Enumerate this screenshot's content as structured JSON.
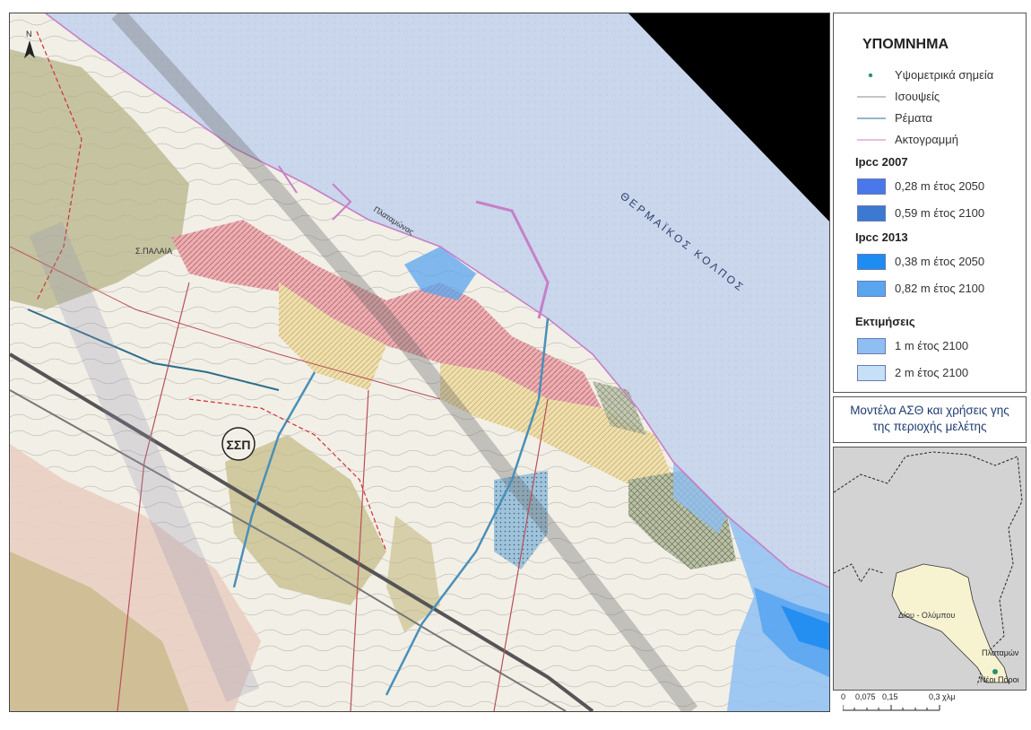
{
  "map": {
    "place_label": "Πλαταμώνας",
    "sea_label": "ΘΕΡΜΑΪΚΟΣ ΚΟΛΠΟΣ",
    "zone_label": "ΣΣΠ",
    "north_label": "N",
    "hill_label": "Σ.ΠΑΛΑΙΑ"
  },
  "legend": {
    "title": "ΥΠΟΜΝΗΜΑ",
    "items": [
      {
        "label": "Υψομετρικά σημεία",
        "symbol": "point",
        "color": "#2f8f6f"
      },
      {
        "label": "Ισουψείς",
        "symbol": "line",
        "color": "#8a8a8a"
      },
      {
        "label": "Ρέματα",
        "symbol": "line",
        "color": "#2c6e8c"
      },
      {
        "label": "Ακτογραμμή",
        "symbol": "line",
        "color": "#c77fc7"
      }
    ],
    "groups": [
      {
        "heading": "Ipcc 2007",
        "items": [
          {
            "label": "0,28 m έτος 2050",
            "color": "#4a78ea"
          },
          {
            "label": "0,59 m έτος 2100",
            "color": "#3b7ad0"
          }
        ]
      },
      {
        "heading": "Ipcc 2013",
        "items": [
          {
            "label": "0,38 m έτος 2050",
            "color": "#1e8cf0"
          },
          {
            "label": "0,82 m έτος 2100",
            "color": "#5aa5ef"
          }
        ]
      },
      {
        "heading": "Εκτιμήσεις",
        "items": [
          {
            "label": "1 m έτος 2100",
            "color": "#8fbff2"
          },
          {
            "label": "2 m έτος 2100",
            "color": "#c5e0f7"
          }
        ]
      }
    ]
  },
  "title_box": {
    "line1": "Μοντέλα ΑΣΘ και χρήσεις γης",
    "line2": "της περιοχής μελέτης"
  },
  "inset": {
    "municipality": "Δίου - Ολύμπου",
    "town1": "Πλαταμών",
    "town2": "Νέοι Πόροι",
    "land_color": "#f7f3d1",
    "background_color": "#d3d3d3"
  },
  "scale": {
    "labels": [
      "0",
      "0,075",
      "0,15",
      "0,3 χλμ"
    ]
  }
}
